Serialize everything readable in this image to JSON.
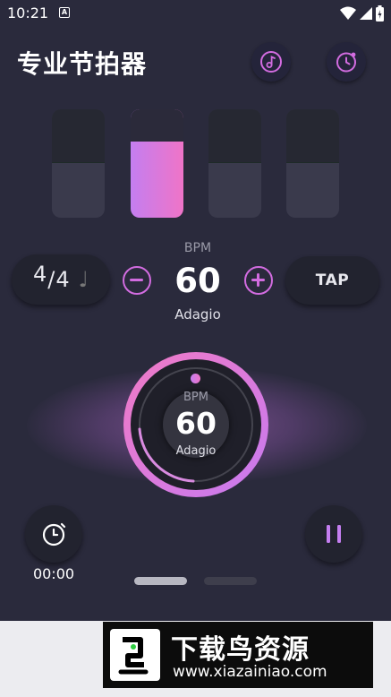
{
  "status": {
    "time": "10:21",
    "notif_letter": "A"
  },
  "header": {
    "title": "专业节拍器",
    "music_icon": "music-note-icon",
    "timer_icon": "timer-icon"
  },
  "beats": [
    {
      "active": false
    },
    {
      "active": true
    },
    {
      "active": false
    },
    {
      "active": false
    }
  ],
  "controls": {
    "time_signature": {
      "numerator": "4",
      "denominator": "4",
      "note": "♩"
    },
    "bpm_label": "BPM",
    "bpm": "60",
    "tempo_name": "Adagio",
    "tap_label": "TAP"
  },
  "dial": {
    "bpm_label": "BPM",
    "bpm": "60",
    "tempo_name": "Adagio"
  },
  "timer": {
    "value": "00:00"
  },
  "pager": {
    "pages": 2,
    "current": 1
  },
  "watermark": {
    "title": "下载鸟资源",
    "url": "www.xiazainiao.com"
  },
  "colors": {
    "background": "#2a2a3c",
    "accent_pink": "#ef74c7",
    "accent_purple": "#c47ef0",
    "control_purple": "#d26ce0"
  }
}
